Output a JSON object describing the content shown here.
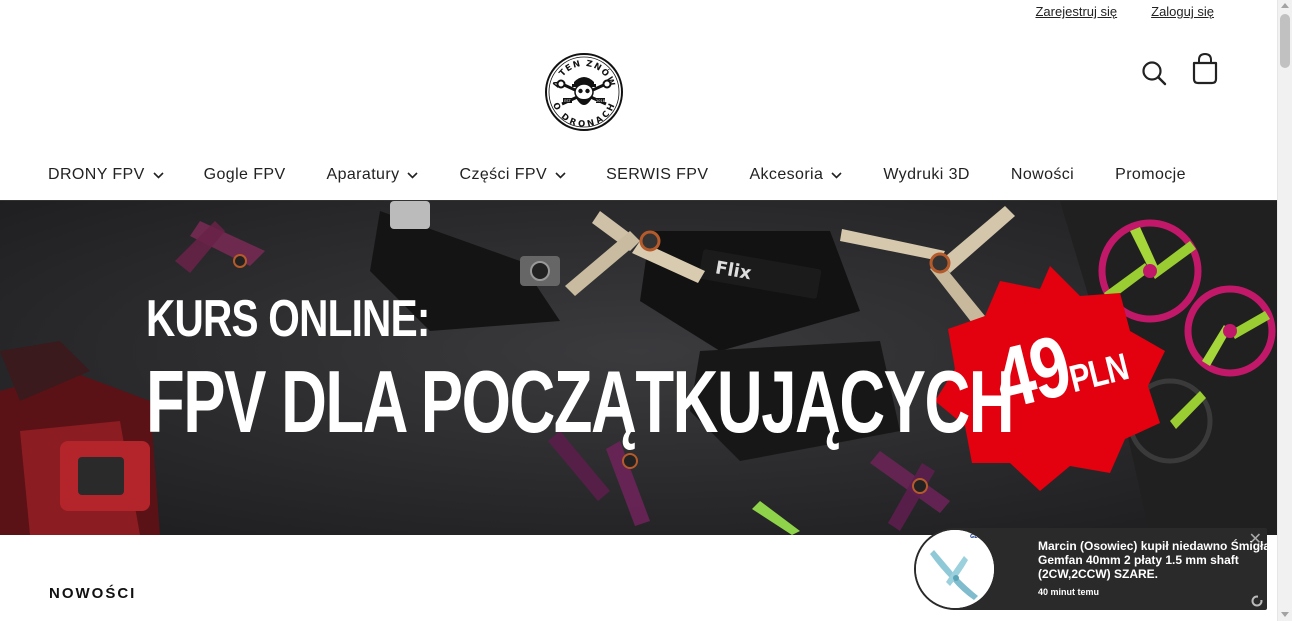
{
  "account": {
    "register_label": "Zarejestruj się",
    "login_label": "Zaloguj się"
  },
  "logo": {
    "top_text": "A TEN ZNÓW",
    "bottom_text": "O DRONACH",
    "est_left": "EST",
    "est_right": "2018"
  },
  "header": {
    "search_icon": "search-icon",
    "cart_icon": "shopping-bag-icon"
  },
  "nav": {
    "items": [
      {
        "label": "DRONY FPV",
        "dropdown": true
      },
      {
        "label": "Gogle FPV",
        "dropdown": false
      },
      {
        "label": "Aparatury",
        "dropdown": true
      },
      {
        "label": "Części FPV",
        "dropdown": true
      },
      {
        "label": "SERWIS FPV",
        "dropdown": false
      },
      {
        "label": "Akcesoria",
        "dropdown": true
      },
      {
        "label": "Wydruki 3D",
        "dropdown": false
      },
      {
        "label": "Nowości",
        "dropdown": false
      },
      {
        "label": "Promocje",
        "dropdown": false
      }
    ]
  },
  "hero": {
    "line1": "KURS ONLINE:",
    "line2": "FPV DLA POCZĄTKUJĄCYCH",
    "price": "49",
    "currency": "PLN",
    "brand_on_frame": "Flix",
    "badge_color": "#e3000f"
  },
  "section": {
    "title": "NOWOŚCI"
  },
  "notification": {
    "message": "Marcin (Osowiec) kupił niedawno Śmigła Gemfan 40mm 2 płaty 1.5 mm shaft (2CW,2CCW) SZARE.",
    "time": "40 minut temu",
    "close_label": "✕",
    "product_brand": "GEMFAN"
  }
}
